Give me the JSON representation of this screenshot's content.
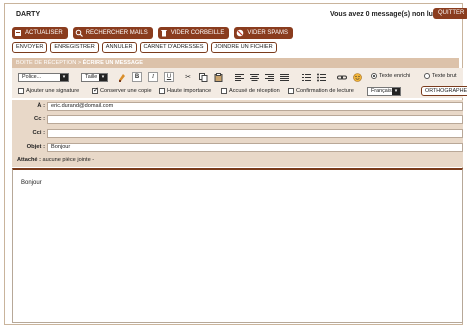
{
  "app": {
    "brand": "DARTY",
    "message_count": "Vous avez 0 message(s) non lu(s)",
    "quit_label": "QUITTER"
  },
  "actions": [
    {
      "label": "ACTUALISER",
      "icon": "refresh-icon"
    },
    {
      "label": "RECHERCHER MAILS",
      "icon": "magnifier-icon"
    },
    {
      "label": "VIDER CORBEILLE",
      "icon": "trash-icon"
    },
    {
      "label": "VIDER SPAMS",
      "icon": "spam-icon"
    }
  ],
  "compose_actions": [
    "ENVOYER",
    "ENREGISTRER",
    "ANNULER",
    "CARNET D'ADRESSES",
    "JOINDRE UN FICHIER"
  ],
  "breadcrumb": {
    "parent": "BOITE DE RÉCEPTION",
    "separator": " > ",
    "current": "ÉCRIRE UN MESSAGE"
  },
  "toolbar": {
    "font_select": "Police...",
    "size_select": "Taille",
    "bold": "B",
    "italic": "I",
    "underline": "U",
    "rich_text_label": "Texte enrichi",
    "plain_text_label": "Texte brut",
    "format_selected": "Texte enrichi"
  },
  "options": [
    {
      "label": "Ajouter une signature",
      "checked": false
    },
    {
      "label": "Conserver une copie",
      "checked": true
    },
    {
      "label": "Haute importance",
      "checked": false
    },
    {
      "label": "Accusé de réception",
      "checked": false
    },
    {
      "label": "Confirmation de lecture",
      "checked": false
    }
  ],
  "language_select": "Français",
  "spellcheck_label": "ORTHOGRAPHE",
  "headers": {
    "to_label": "À :",
    "to_value": "eric.durand@domail.com",
    "cc_label": "Cc :",
    "cc_value": "",
    "bcc_label": "Cci :",
    "bcc_value": "",
    "subject_label": "Objet :",
    "subject_value": "Bonjour",
    "attached_label": "Attaché :",
    "attached_value": "aucune pièce jointe -"
  },
  "body_text": "Bonjour",
  "colors": {
    "accent": "#8a3c1e",
    "breadcrumb_bg": "#dcc2aa",
    "header_bg": "#e8d8c8",
    "toolbar_bg": "#f3ebe3"
  }
}
